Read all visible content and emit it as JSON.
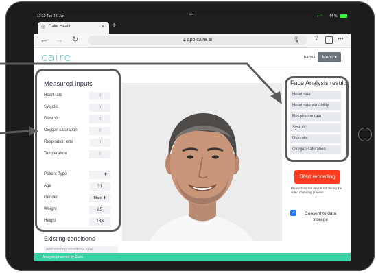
{
  "status_bar": {
    "time": "17:13  Tue 24. Jan",
    "battery": "44 %"
  },
  "browser": {
    "tab_title": "Caire Health",
    "url": "app.caire.ai"
  },
  "app": {
    "logo": "caire",
    "user": "hamdi",
    "menu_label": "Menu ▾"
  },
  "measured_inputs": {
    "title": "Measured Inputs",
    "vitals": [
      {
        "label": "Heart rate",
        "value": "0"
      },
      {
        "label": "Systolic",
        "value": "0"
      },
      {
        "label": "Diastolic",
        "value": "0"
      },
      {
        "label": "Oxygen saturation",
        "value": "0"
      },
      {
        "label": "Respiration rate",
        "value": "0"
      },
      {
        "label": "Temperature",
        "value": "0"
      }
    ],
    "patient": [
      {
        "label": "Patient Type",
        "value": "⬍"
      },
      {
        "label": "Age",
        "value": "31"
      },
      {
        "label": "Gender",
        "value": "Male ⬍"
      },
      {
        "label": "Weight",
        "value": "85"
      },
      {
        "label": "Height",
        "value": "183"
      }
    ]
  },
  "existing_conditions": {
    "title": "Existing conditions",
    "placeholder": "Add existing conditions here"
  },
  "face_analysis": {
    "title": "Face Analysis results",
    "items": [
      "Heart rate",
      "Heart rate variability",
      "Respiration rate",
      "Systolic",
      "Diastolic",
      "Oxygen saturation"
    ]
  },
  "actions": {
    "start_label": "Start recording",
    "hint": "Please hold the device still during the video capturing process",
    "consent_label": "Consent to data storage"
  },
  "footer": "Analysis powered by Caire",
  "colors": {
    "accent": "#ff3b1f",
    "brand": "#3fbfc4",
    "footer": "#3ccfa3",
    "checkbox": "#1e78ff"
  }
}
